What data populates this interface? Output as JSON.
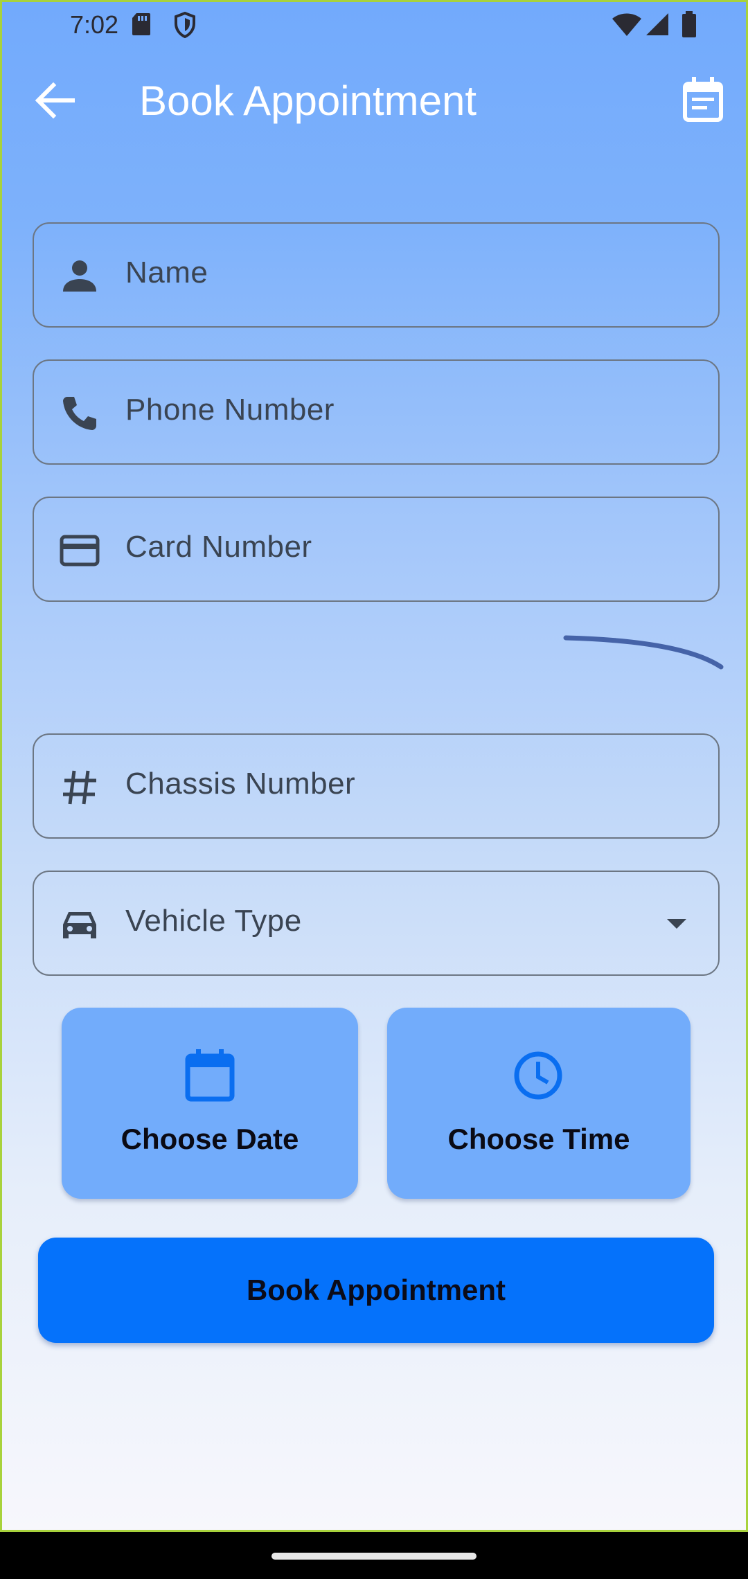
{
  "status_bar": {
    "time": "7:02",
    "icons": [
      "sd-card-icon",
      "shield-icon",
      "wifi-icon",
      "signal-icon",
      "battery-icon"
    ]
  },
  "app_bar": {
    "title": "Book Appointment",
    "back_icon": "arrow-left-icon",
    "action_icon": "calendar-event-icon"
  },
  "form": {
    "name": {
      "label": "Name",
      "icon": "person-icon"
    },
    "phone": {
      "label": "Phone Number",
      "icon": "phone-icon"
    },
    "card": {
      "label": "Card Number",
      "icon": "credit-card-icon"
    },
    "chassis": {
      "label": "Chassis Number",
      "icon": "hash-icon"
    },
    "vehicle_type": {
      "label": "Vehicle Type",
      "icon": "car-icon"
    }
  },
  "choose_date": {
    "label": "Choose Date",
    "icon": "calendar-icon"
  },
  "choose_time": {
    "label": "Choose Time",
    "icon": "clock-icon"
  },
  "submit": {
    "label": "Book Appointment"
  },
  "colors": {
    "accent": "#0572fb",
    "card_bg": "#72acfb",
    "icon_blue": "#0a6ef0",
    "text_dark": "#0a0a14"
  }
}
